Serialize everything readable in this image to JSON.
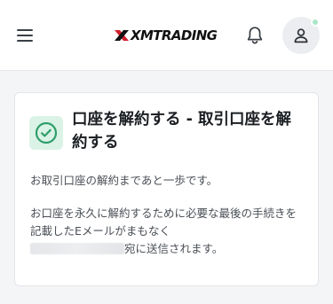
{
  "header": {
    "menu_icon": "hamburger-menu-icon",
    "logo_text": "XMTRADING",
    "notification_icon": "bell-icon",
    "profile_icon": "user-icon",
    "status_dot_color": "#a8e6c8"
  },
  "card": {
    "status_icon": "check-circle-icon",
    "status_color": "#2f9e6a",
    "title": "口座を解約する - 取引口座を解約する",
    "message_1": "お取引口座の解約まであと一歩です。",
    "message_2_prefix": "お口座を永久に解約するために必要な最後の手続きを記載したEメールがまもなく",
    "message_2_suffix": "宛に送信されます。"
  }
}
